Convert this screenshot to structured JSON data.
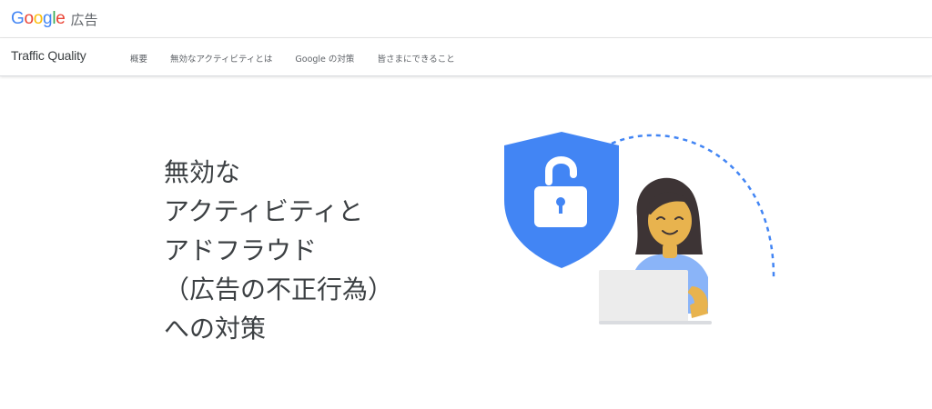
{
  "header": {
    "logo_word": [
      "G",
      "o",
      "o",
      "g",
      "l",
      "e"
    ],
    "logo_colors": [
      "#4285F4",
      "#EA4335",
      "#FBBC05",
      "#4285F4",
      "#34A853",
      "#EA4335"
    ],
    "product": "広告"
  },
  "subnav": {
    "title": "Traffic Quality",
    "links": [
      "概要",
      "無効なアクティビティとは",
      "Google の対策",
      "皆さまにできること"
    ]
  },
  "hero": {
    "lines": [
      "無効な",
      "アクティビティと",
      "アドフラウド",
      "（広告の不正行為）",
      "への対策"
    ]
  },
  "colors": {
    "shield": "#4285F4",
    "dashed_arc": "#4285F4",
    "skin": "#E8B34E",
    "hair": "#3D3435",
    "shirt": "#8AB4F8",
    "laptop": "#ECECEC"
  }
}
